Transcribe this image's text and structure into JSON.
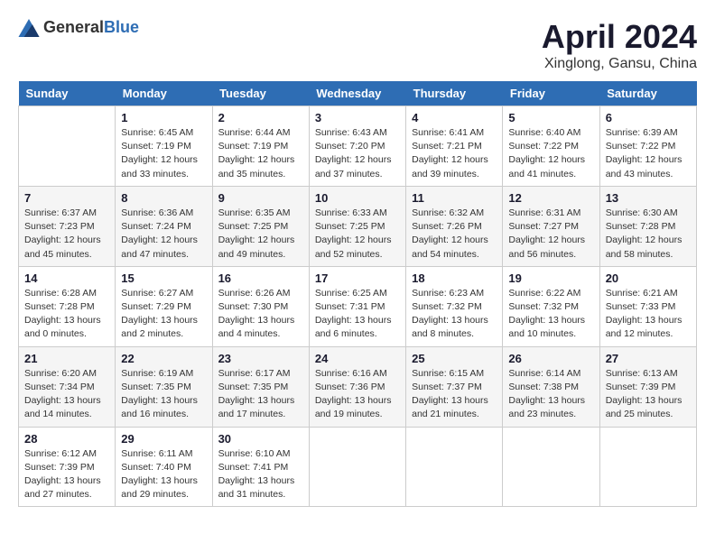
{
  "header": {
    "logo_general": "General",
    "logo_blue": "Blue",
    "month": "April 2024",
    "location": "Xinglong, Gansu, China"
  },
  "weekdays": [
    "Sunday",
    "Monday",
    "Tuesday",
    "Wednesday",
    "Thursday",
    "Friday",
    "Saturday"
  ],
  "weeks": [
    [
      {
        "day": "",
        "info": ""
      },
      {
        "day": "1",
        "info": "Sunrise: 6:45 AM\nSunset: 7:19 PM\nDaylight: 12 hours\nand 33 minutes."
      },
      {
        "day": "2",
        "info": "Sunrise: 6:44 AM\nSunset: 7:19 PM\nDaylight: 12 hours\nand 35 minutes."
      },
      {
        "day": "3",
        "info": "Sunrise: 6:43 AM\nSunset: 7:20 PM\nDaylight: 12 hours\nand 37 minutes."
      },
      {
        "day": "4",
        "info": "Sunrise: 6:41 AM\nSunset: 7:21 PM\nDaylight: 12 hours\nand 39 minutes."
      },
      {
        "day": "5",
        "info": "Sunrise: 6:40 AM\nSunset: 7:22 PM\nDaylight: 12 hours\nand 41 minutes."
      },
      {
        "day": "6",
        "info": "Sunrise: 6:39 AM\nSunset: 7:22 PM\nDaylight: 12 hours\nand 43 minutes."
      }
    ],
    [
      {
        "day": "7",
        "info": "Sunrise: 6:37 AM\nSunset: 7:23 PM\nDaylight: 12 hours\nand 45 minutes."
      },
      {
        "day": "8",
        "info": "Sunrise: 6:36 AM\nSunset: 7:24 PM\nDaylight: 12 hours\nand 47 minutes."
      },
      {
        "day": "9",
        "info": "Sunrise: 6:35 AM\nSunset: 7:25 PM\nDaylight: 12 hours\nand 49 minutes."
      },
      {
        "day": "10",
        "info": "Sunrise: 6:33 AM\nSunset: 7:25 PM\nDaylight: 12 hours\nand 52 minutes."
      },
      {
        "day": "11",
        "info": "Sunrise: 6:32 AM\nSunset: 7:26 PM\nDaylight: 12 hours\nand 54 minutes."
      },
      {
        "day": "12",
        "info": "Sunrise: 6:31 AM\nSunset: 7:27 PM\nDaylight: 12 hours\nand 56 minutes."
      },
      {
        "day": "13",
        "info": "Sunrise: 6:30 AM\nSunset: 7:28 PM\nDaylight: 12 hours\nand 58 minutes."
      }
    ],
    [
      {
        "day": "14",
        "info": "Sunrise: 6:28 AM\nSunset: 7:28 PM\nDaylight: 13 hours\nand 0 minutes."
      },
      {
        "day": "15",
        "info": "Sunrise: 6:27 AM\nSunset: 7:29 PM\nDaylight: 13 hours\nand 2 minutes."
      },
      {
        "day": "16",
        "info": "Sunrise: 6:26 AM\nSunset: 7:30 PM\nDaylight: 13 hours\nand 4 minutes."
      },
      {
        "day": "17",
        "info": "Sunrise: 6:25 AM\nSunset: 7:31 PM\nDaylight: 13 hours\nand 6 minutes."
      },
      {
        "day": "18",
        "info": "Sunrise: 6:23 AM\nSunset: 7:32 PM\nDaylight: 13 hours\nand 8 minutes."
      },
      {
        "day": "19",
        "info": "Sunrise: 6:22 AM\nSunset: 7:32 PM\nDaylight: 13 hours\nand 10 minutes."
      },
      {
        "day": "20",
        "info": "Sunrise: 6:21 AM\nSunset: 7:33 PM\nDaylight: 13 hours\nand 12 minutes."
      }
    ],
    [
      {
        "day": "21",
        "info": "Sunrise: 6:20 AM\nSunset: 7:34 PM\nDaylight: 13 hours\nand 14 minutes."
      },
      {
        "day": "22",
        "info": "Sunrise: 6:19 AM\nSunset: 7:35 PM\nDaylight: 13 hours\nand 16 minutes."
      },
      {
        "day": "23",
        "info": "Sunrise: 6:17 AM\nSunset: 7:35 PM\nDaylight: 13 hours\nand 17 minutes."
      },
      {
        "day": "24",
        "info": "Sunrise: 6:16 AM\nSunset: 7:36 PM\nDaylight: 13 hours\nand 19 minutes."
      },
      {
        "day": "25",
        "info": "Sunrise: 6:15 AM\nSunset: 7:37 PM\nDaylight: 13 hours\nand 21 minutes."
      },
      {
        "day": "26",
        "info": "Sunrise: 6:14 AM\nSunset: 7:38 PM\nDaylight: 13 hours\nand 23 minutes."
      },
      {
        "day": "27",
        "info": "Sunrise: 6:13 AM\nSunset: 7:39 PM\nDaylight: 13 hours\nand 25 minutes."
      }
    ],
    [
      {
        "day": "28",
        "info": "Sunrise: 6:12 AM\nSunset: 7:39 PM\nDaylight: 13 hours\nand 27 minutes."
      },
      {
        "day": "29",
        "info": "Sunrise: 6:11 AM\nSunset: 7:40 PM\nDaylight: 13 hours\nand 29 minutes."
      },
      {
        "day": "30",
        "info": "Sunrise: 6:10 AM\nSunset: 7:41 PM\nDaylight: 13 hours\nand 31 minutes."
      },
      {
        "day": "",
        "info": ""
      },
      {
        "day": "",
        "info": ""
      },
      {
        "day": "",
        "info": ""
      },
      {
        "day": "",
        "info": ""
      }
    ]
  ]
}
